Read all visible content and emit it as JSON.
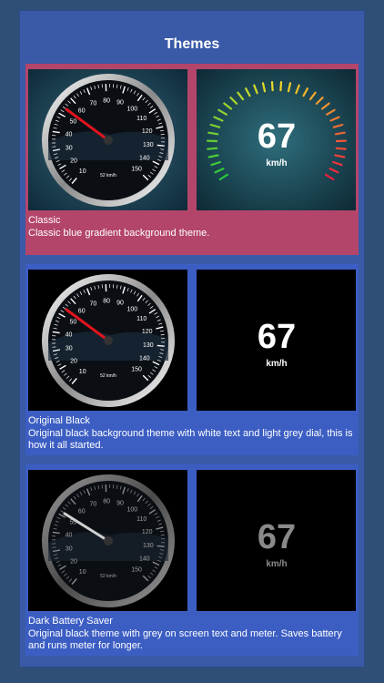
{
  "header": {
    "title": "Themes"
  },
  "themes": [
    {
      "name": "Classic",
      "description": "Classic blue gradient background theme.",
      "speed": "67",
      "unit": "km/h",
      "dial_readout": "52 km/h"
    },
    {
      "name": "Original Black",
      "description": "Original black background theme with white text and light grey dial, this is how it all started.",
      "speed": "67",
      "unit": "km/h",
      "dial_readout": "52 km/h"
    },
    {
      "name": "Dark Battery Saver",
      "description": "Original black theme with grey on screen text and meter. Saves battery and runs meter for longer.",
      "speed": "67",
      "unit": "km/h",
      "dial_readout": "52 km/h"
    }
  ],
  "dial_scale": [
    "10",
    "20",
    "30",
    "40",
    "50",
    "60",
    "70",
    "80",
    "90",
    "100",
    "110",
    "120",
    "130",
    "140",
    "150"
  ],
  "colors": {
    "page_bg": "#2f4f77",
    "panel_bg": "#3a5aa8",
    "card_bg": "#3c5ec3",
    "selected_card_bg": "#b3456b",
    "needle_red": "#e0141e"
  }
}
